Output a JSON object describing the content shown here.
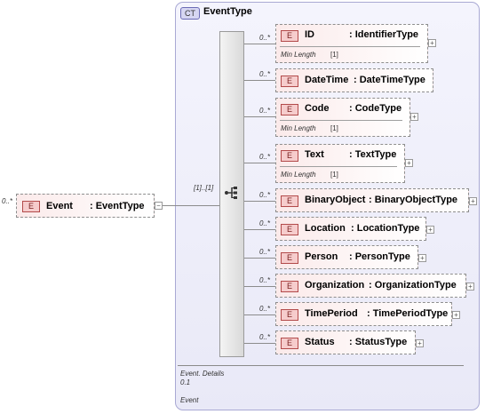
{
  "root": {
    "cardinality": "0..*",
    "badge": "E",
    "name": "Event",
    "type": ": EventType",
    "expand": "−"
  },
  "complex_type": {
    "badge": "CT",
    "title": "EventType"
  },
  "sequence": {
    "cardinality": "[1]..[1]"
  },
  "children": [
    {
      "card": "0..*",
      "badge": "E",
      "name": "ID",
      "type": ": IdentifierType",
      "facet_label": "Min Length",
      "facet_value": "[1]",
      "expand": "+"
    },
    {
      "card": "0..*",
      "badge": "E",
      "name": "DateTime",
      "type": ": DateTimeType"
    },
    {
      "card": "0..*",
      "badge": "E",
      "name": "Code",
      "type": ": CodeType",
      "facet_label": "Min Length",
      "facet_value": "[1]",
      "expand": "+"
    },
    {
      "card": "0..*",
      "badge": "E",
      "name": "Text",
      "type": ": TextType",
      "facet_label": "Min Length",
      "facet_value": "[1]",
      "expand": "+"
    },
    {
      "card": "0..*",
      "badge": "E",
      "name": "BinaryObject",
      "type": ": BinaryObjectType",
      "expand": "+"
    },
    {
      "card": "0..*",
      "badge": "E",
      "name": "Location",
      "type": ": LocationType",
      "expand": "+"
    },
    {
      "card": "0..*",
      "badge": "E",
      "name": "Person",
      "type": ": PersonType",
      "expand": "+"
    },
    {
      "card": "0..*",
      "badge": "E",
      "name": "Organization",
      "type": ": OrganizationType",
      "expand": "+"
    },
    {
      "card": "0..*",
      "badge": "E",
      "name": "TimePeriod",
      "type": ": TimePeriodType",
      "expand": "+"
    },
    {
      "card": "0..*",
      "badge": "E",
      "name": "Status",
      "type": ": StatusType",
      "expand": "+"
    }
  ],
  "footer": {
    "line1": "Event. Details",
    "line2": "0.1",
    "line3": "Event"
  }
}
